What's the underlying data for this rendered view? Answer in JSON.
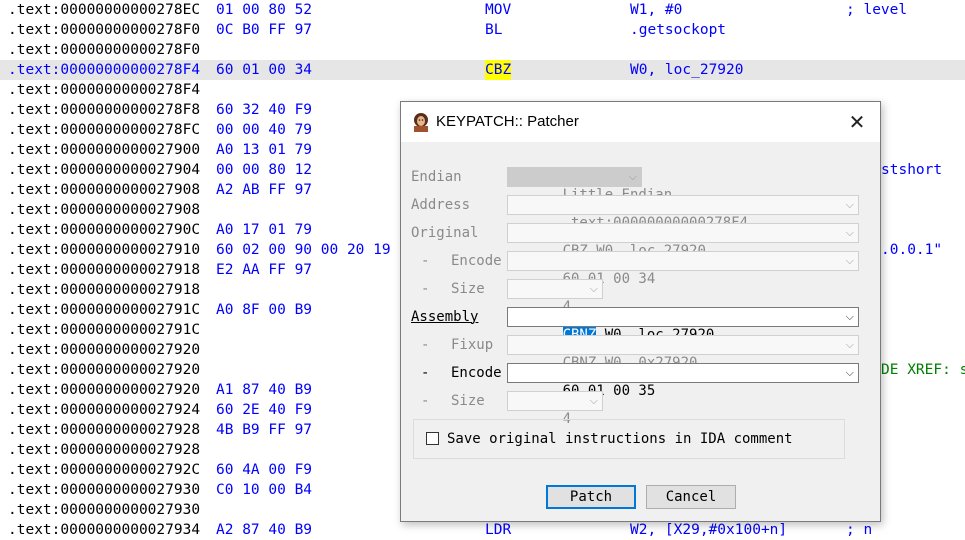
{
  "listing": [
    {
      "addr": ".text:00000000000278EC",
      "bytes": "01 00 80 52",
      "mnemonic": "MOV",
      "operands": "W1, #0",
      "comment": "; level"
    },
    {
      "addr": ".text:00000000000278F0",
      "bytes": "0C B0 FF 97",
      "mnemonic": "BL",
      "operands": ".getsockopt",
      "comment": ""
    },
    {
      "addr": ".text:00000000000278F0",
      "bytes": "",
      "mnemonic": "",
      "operands": "",
      "comment": ""
    },
    {
      "addr": ".text:00000000000278F4",
      "bytes": "60 01 00 34",
      "mnemonic": "CBZ",
      "operands": "W0, loc_27920",
      "comment": "",
      "highlight": true
    },
    {
      "addr": ".text:00000000000278F4",
      "bytes": "",
      "mnemonic": "",
      "operands": "",
      "comment": ""
    },
    {
      "addr": ".text:00000000000278F8",
      "bytes": "60 32 40 F9",
      "mnemonic": "",
      "operands": "",
      "comment": ""
    },
    {
      "addr": ".text:00000000000278FC",
      "bytes": "00 00 40 79",
      "mnemonic": "",
      "operands": "",
      "comment": ""
    },
    {
      "addr": ".text:0000000000027900",
      "bytes": "A0 13 01 79",
      "mnemonic": "",
      "operands": "",
      "comment": ""
    },
    {
      "addr": ".text:0000000000027904",
      "bytes": "00 00 80 12",
      "mnemonic": "",
      "operands": "",
      "comment": "",
      "tail": "stshort"
    },
    {
      "addr": ".text:0000000000027908",
      "bytes": "A2 AB FF 97",
      "mnemonic": "",
      "operands": "",
      "comment": ""
    },
    {
      "addr": ".text:0000000000027908",
      "bytes": "",
      "mnemonic": "",
      "operands": "",
      "comment": ""
    },
    {
      "addr": ".text:000000000002790C",
      "bytes": "A0 17 01 79",
      "mnemonic": "",
      "operands": "",
      "comment": ""
    },
    {
      "addr": ".text:0000000000027910",
      "bytes": "60 02 00 90 00 20 19",
      "mnemonic": "",
      "operands": "",
      "comment": "",
      "tail": ".0.0.1\""
    },
    {
      "addr": ".text:0000000000027918",
      "bytes": "E2 AA FF 97",
      "mnemonic": "",
      "operands": "",
      "comment": ""
    },
    {
      "addr": ".text:0000000000027918",
      "bytes": "",
      "mnemonic": "",
      "operands": "",
      "comment": ""
    },
    {
      "addr": ".text:000000000002791C",
      "bytes": "A0 8F 00 B9",
      "mnemonic": "",
      "operands": "",
      "comment": ""
    },
    {
      "addr": ".text:000000000002791C",
      "bytes": "",
      "mnemonic": "",
      "operands": "",
      "comment": ""
    },
    {
      "addr": ".text:0000000000027920",
      "bytes": "",
      "mnemonic": "",
      "operands": "",
      "comment": ""
    },
    {
      "addr": ".text:0000000000027920",
      "bytes": "",
      "mnemonic": "",
      "operands": "",
      "comment": "",
      "tail": "DE XREF: s",
      "tail_green": true
    },
    {
      "addr": ".text:0000000000027920",
      "bytes": "A1 87 40 B9",
      "mnemonic": "",
      "operands": "",
      "comment": ""
    },
    {
      "addr": ".text:0000000000027924",
      "bytes": "60 2E 40 F9",
      "mnemonic": "",
      "operands": "",
      "comment": ""
    },
    {
      "addr": ".text:0000000000027928",
      "bytes": "4B B9 FF 97",
      "mnemonic": "",
      "operands": "",
      "comment": ""
    },
    {
      "addr": ".text:0000000000027928",
      "bytes": "",
      "mnemonic": "",
      "operands": "",
      "comment": ""
    },
    {
      "addr": ".text:000000000002792C",
      "bytes": "60 4A 00 F9",
      "mnemonic": "",
      "operands": "",
      "comment": ""
    },
    {
      "addr": ".text:0000000000027930",
      "bytes": "C0 10 00 B4",
      "mnemonic": "",
      "operands": "",
      "comment": ""
    },
    {
      "addr": ".text:0000000000027930",
      "bytes": "",
      "mnemonic": "",
      "operands": "",
      "comment": ""
    },
    {
      "addr": ".text:0000000000027934",
      "bytes": "A2 87 40 B9",
      "mnemonic": "LDR",
      "operands": "W2, [X29,#0x100+n]",
      "comment": "; n"
    }
  ],
  "dialog": {
    "title": "KEYPATCH:: Patcher",
    "close_glyph": "✕",
    "endian_label": "Endian",
    "endian_value": "Little Endian",
    "address_label": "Address",
    "address_value": ".text:00000000000278F4",
    "original_label": "Original",
    "original_value": "CBZ W0, loc_27920",
    "orig_encode_label": "Encode",
    "orig_encode_value": "60 01 00 34",
    "orig_size_label": "Size",
    "orig_size_value": "4",
    "assembly_label": "Assembly",
    "assembly_selected": "CBNZ",
    "assembly_rest": " W0, loc_27920",
    "fixup_label": "Fixup",
    "fixup_value": "CBNZ W0, 0x27920",
    "new_encode_label": "Encode",
    "new_encode_value": "60 01 00 35",
    "new_size_label": "Size",
    "new_size_value": "4",
    "dash": "-",
    "save_original_label": "Save original instructions in IDA comment",
    "save_original_checked": false,
    "patch_label": "Patch",
    "cancel_label": "Cancel",
    "dropdown_glyph": "⌵"
  },
  "colors": {
    "listing_blue": "#0000ff",
    "highlight_row": "#e6e6e6",
    "mnemonic_highlight": "#ffff00",
    "selection": "#0078d7",
    "xref_green": "#008000"
  }
}
